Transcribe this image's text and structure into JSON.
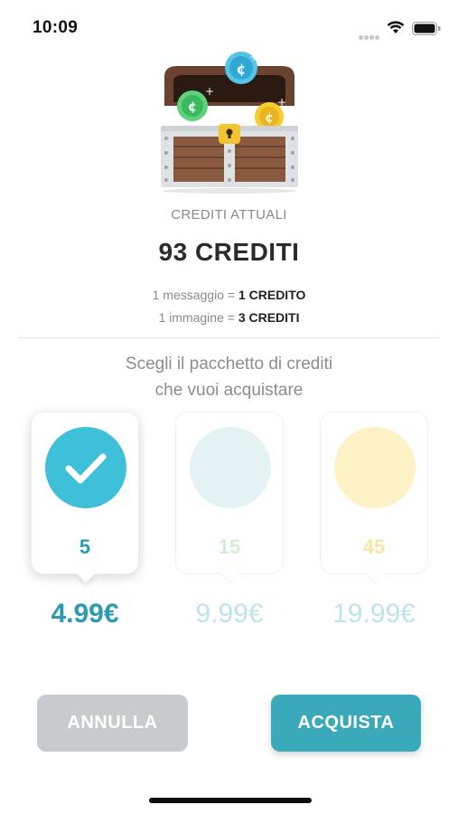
{
  "status_bar": {
    "time": "10:09"
  },
  "header": {
    "current_label": "CREDITI ATTUALI",
    "credit_total": "93 CREDITI"
  },
  "rates": [
    {
      "label": "1 messaggio = ",
      "value": "1 CREDITO"
    },
    {
      "label": "1 immagine = ",
      "value": "3 CREDITI"
    }
  ],
  "prompt": {
    "line1": "Scegli il pacchetto di crediti",
    "line2": "che vuoi acquistare"
  },
  "packages": [
    {
      "credits": "5",
      "price": "4.99€",
      "selected": true,
      "circle_color": "#3ec0d8",
      "amount_color": "#2a9bb0"
    },
    {
      "credits": "15",
      "price": "9.99€",
      "selected": false,
      "circle_color": "#e3f3f4",
      "amount_color": "#d6ecd4"
    },
    {
      "credits": "45",
      "price": "19.99€",
      "selected": false,
      "circle_color": "#fdf2c6",
      "amount_color": "#f7e7a6"
    }
  ],
  "buttons": {
    "cancel_label": "ANNULLA",
    "buy_label": "ACQUISTA"
  },
  "icons": {
    "status": [
      "wifi-icon",
      "battery-icon"
    ],
    "chest": "treasure-chest-icon",
    "check": "checkmark-icon"
  },
  "colors": {
    "accent": "#3aaabb",
    "cancel_bg": "#c8cbce"
  }
}
